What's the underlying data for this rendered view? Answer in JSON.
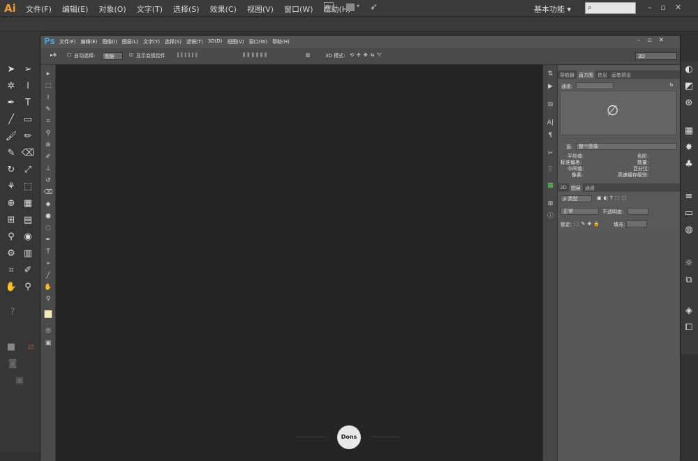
{
  "ai": {
    "logo": "Ai",
    "menu": [
      "文件(F)",
      "编辑(E)",
      "对象(O)",
      "文字(T)",
      "选择(S)",
      "效果(C)",
      "视图(V)",
      "窗口(W)",
      "帮助(H)"
    ],
    "bridge": "Br",
    "workspace": "基本功能",
    "workspace_arrow": "▾",
    "search_icon": "⌕",
    "window_buttons": "–▫✕"
  },
  "ps": {
    "logo": "Ps",
    "menu": [
      "文件(F)",
      "编辑(E)",
      "图像(I)",
      "图层(L)",
      "文字(Y)",
      "选择(S)",
      "滤镜(T)",
      "3D(D)",
      "视图(V)",
      "窗口(W)",
      "帮助(H)"
    ],
    "window_buttons": "–▫✕",
    "options": {
      "auto_select": "自动选择:",
      "layer_select": "图层",
      "show_transform": "显示变换控件",
      "mode_3d": "3D 模式:",
      "workspace": "3D"
    },
    "panels": {
      "top_tabs": [
        "导航器",
        "直方图",
        "信息",
        "画笔预设"
      ],
      "top_active": 1,
      "channel_label": "通道:",
      "source_label": "源:",
      "source_value": "整个图像",
      "stats_left": [
        "平均值:",
        "标准偏差:",
        "中间值:",
        "像素:"
      ],
      "stats_right": [
        "色阶:",
        "数量:",
        "百分位:",
        "高速缓存级别:"
      ],
      "null_symbol": "∅",
      "layer_tabs": [
        "3D",
        "图层",
        "通道"
      ],
      "layer_active": 1,
      "kind_label": "ρ 类型",
      "blend_mode": "正常",
      "opacity_label": "不透明度:",
      "lock_label": "锁定:",
      "fill_label": "填充:"
    }
  },
  "watermark": {
    "text": "Dons"
  }
}
